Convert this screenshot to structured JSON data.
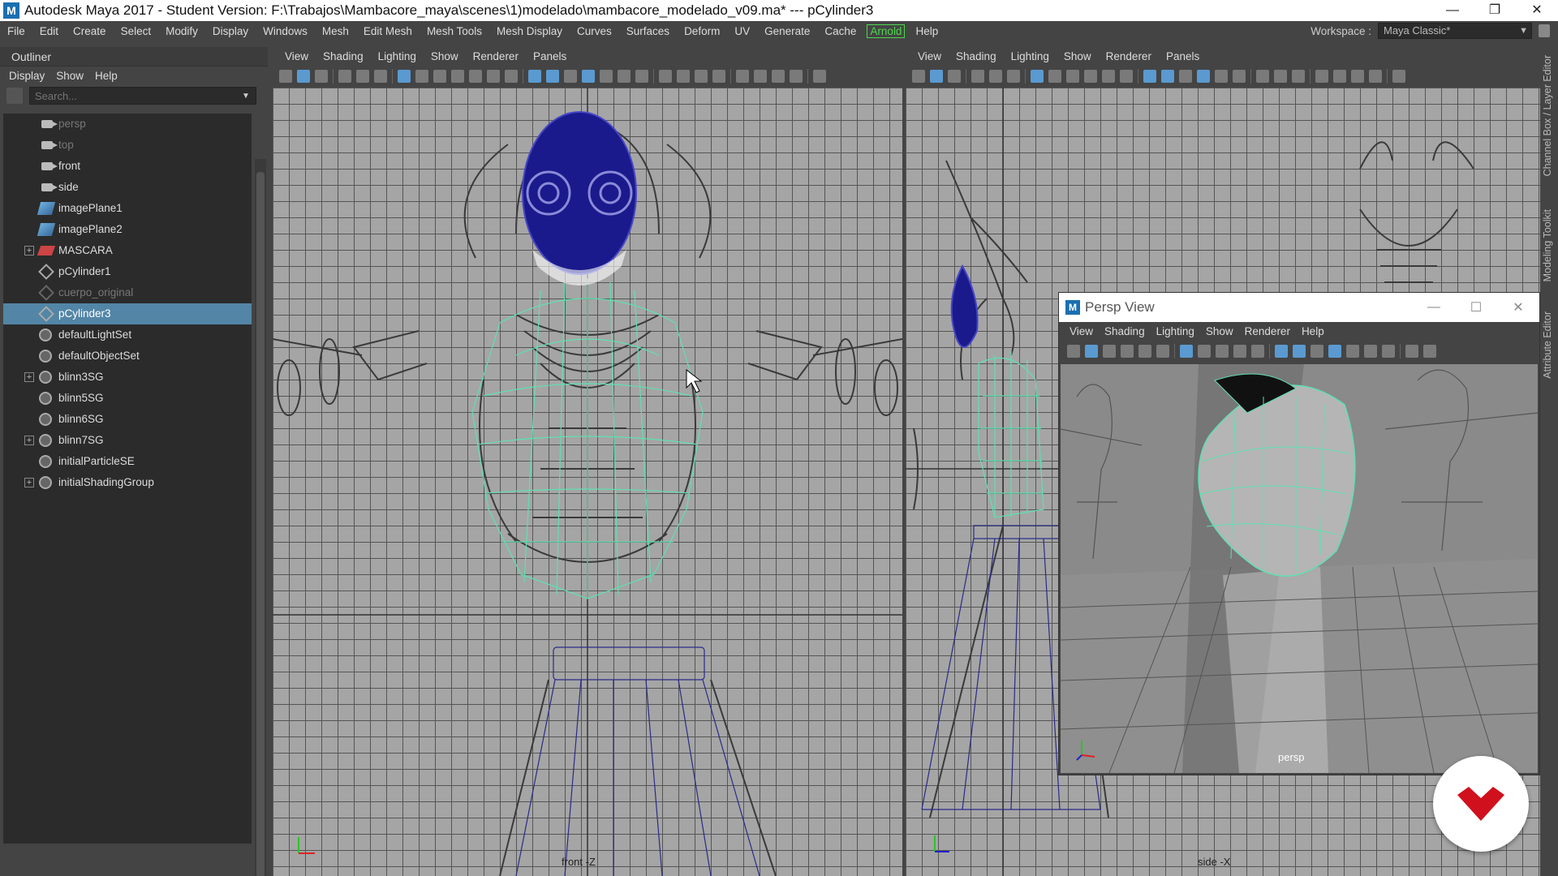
{
  "window": {
    "title": "Autodesk Maya 2017 - Student Version: F:\\Trabajos\\Mambacore_maya\\scenes\\1)modelado\\mambacore_modelado_v09.ma*   ---   pCylinder3",
    "app_icon": "M"
  },
  "menubar": {
    "items": [
      "File",
      "Edit",
      "Create",
      "Select",
      "Modify",
      "Display",
      "Windows",
      "Mesh",
      "Edit Mesh",
      "Mesh Tools",
      "Mesh Display",
      "Curves",
      "Surfaces",
      "Deform",
      "UV",
      "Generate",
      "Cache",
      "Arnold",
      "Help"
    ],
    "workspace_label": "Workspace :",
    "workspace_value": "Maya Classic*"
  },
  "outliner": {
    "title": "Outliner",
    "menu": [
      "Display",
      "Show",
      "Help"
    ],
    "search_placeholder": "Search...",
    "items": [
      {
        "label": "persp",
        "icon": "camera-icon",
        "dim": true,
        "expandable": false
      },
      {
        "label": "top",
        "icon": "camera-icon",
        "dim": true,
        "expandable": false
      },
      {
        "label": "front",
        "icon": "camera-icon",
        "dim": false,
        "expandable": false
      },
      {
        "label": "side",
        "icon": "camera-icon",
        "dim": false,
        "expandable": false
      },
      {
        "label": "imagePlane1",
        "icon": "image-plane-icon",
        "dim": false,
        "expandable": false
      },
      {
        "label": "imagePlane2",
        "icon": "image-plane-icon",
        "dim": false,
        "expandable": false
      },
      {
        "label": "MASCARA",
        "icon": "group-icon",
        "dim": false,
        "expandable": true
      },
      {
        "label": "pCylinder1",
        "icon": "mesh-icon",
        "dim": false,
        "expandable": false
      },
      {
        "label": "cuerpo_original",
        "icon": "mesh-icon",
        "dim": true,
        "expandable": false
      },
      {
        "label": "pCylinder3",
        "icon": "mesh-icon",
        "dim": false,
        "expandable": false,
        "selected": true
      },
      {
        "label": "defaultLightSet",
        "icon": "set-icon",
        "dim": false,
        "expandable": false
      },
      {
        "label": "defaultObjectSet",
        "icon": "set-icon",
        "dim": false,
        "expandable": false
      },
      {
        "label": "blinn3SG",
        "icon": "set-icon",
        "dim": false,
        "expandable": true
      },
      {
        "label": "blinn5SG",
        "icon": "set-icon",
        "dim": false,
        "expandable": false
      },
      {
        "label": "blinn6SG",
        "icon": "set-icon",
        "dim": false,
        "expandable": false
      },
      {
        "label": "blinn7SG",
        "icon": "set-icon",
        "dim": false,
        "expandable": true
      },
      {
        "label": "initialParticleSE",
        "icon": "set-icon",
        "dim": false,
        "expandable": false
      },
      {
        "label": "initialShadingGroup",
        "icon": "set-icon",
        "dim": false,
        "expandable": true
      }
    ]
  },
  "viewport_front": {
    "menu": [
      "View",
      "Shading",
      "Lighting",
      "Show",
      "Renderer",
      "Panels"
    ],
    "camera_label": "front -Z"
  },
  "viewport_side": {
    "menu": [
      "View",
      "Shading",
      "Lighting",
      "Show",
      "Renderer",
      "Panels"
    ],
    "camera_label": "side -X"
  },
  "persp_window": {
    "title": "Persp View",
    "menu": [
      "View",
      "Shading",
      "Lighting",
      "Show",
      "Renderer",
      "Help"
    ],
    "camera_label": "persp"
  },
  "side_tabs": [
    "Channel Box / Layer Editor",
    "Modeling Toolkit",
    "Attribute Editor"
  ],
  "colors": {
    "selection": "#5285a6",
    "arnold": "#4cd94c",
    "wireframe_selected": "#5fe0b0",
    "wireframe_blue": "#1a1a8c",
    "brand_red": "#d0101c"
  }
}
